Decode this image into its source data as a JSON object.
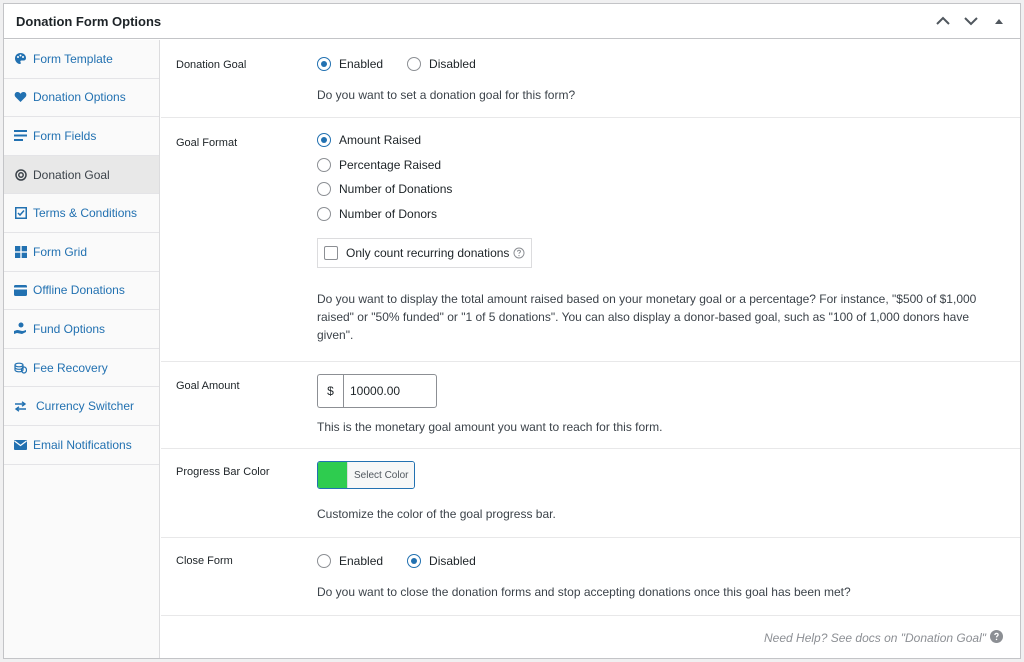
{
  "panel": {
    "title": "Donation Form Options"
  },
  "sidebar": {
    "items": [
      {
        "label": "Form Template",
        "icon": "palette-icon"
      },
      {
        "label": "Donation Options",
        "icon": "heart-icon"
      },
      {
        "label": "Form Fields",
        "icon": "list-icon"
      },
      {
        "label": "Donation Goal",
        "icon": "target-icon"
      },
      {
        "label": "Terms & Conditions",
        "icon": "checkbox-icon"
      },
      {
        "label": "Form Grid",
        "icon": "grid-icon"
      },
      {
        "label": "Offline Donations",
        "icon": "card-icon"
      },
      {
        "label": "Fund Options",
        "icon": "hand-coin-icon"
      },
      {
        "label": "Fee Recovery",
        "icon": "coins-icon"
      },
      {
        "label": "Currency Switcher",
        "icon": "arrows-icon"
      },
      {
        "label": "Email Notifications",
        "icon": "envelope-icon"
      }
    ]
  },
  "donation_goal": {
    "label": "Donation Goal",
    "options": [
      "Enabled",
      "Disabled"
    ],
    "selected": "Enabled",
    "description": "Do you want to set a donation goal for this form?"
  },
  "goal_format": {
    "label": "Goal Format",
    "options": [
      "Amount Raised",
      "Percentage Raised",
      "Number of Donations",
      "Number of Donors"
    ],
    "selected": "Amount Raised",
    "checkbox_label": "Only count recurring donations",
    "description": "Do you want to display the total amount raised based on your monetary goal or a percentage? For instance, \"$500 of $1,000 raised\" or \"50% funded\" or \"1 of 5 donations\". You can also display a donor-based goal, such as \"100 of 1,000 donors have given\"."
  },
  "goal_amount": {
    "label": "Goal Amount",
    "currency": "$",
    "value": "10000.00",
    "description": "This is the monetary goal amount you want to reach for this form."
  },
  "progress_bar_color": {
    "label": "Progress Bar Color",
    "color": "#2ecc4f",
    "button_label": "Select Color",
    "description": "Customize the color of the goal progress bar."
  },
  "close_form": {
    "label": "Close Form",
    "options": [
      "Enabled",
      "Disabled"
    ],
    "selected": "Disabled",
    "description": "Do you want to close the donation forms and stop accepting donations once this goal has been met?"
  },
  "footer": {
    "help_text": "Need Help? See docs on \"Donation Goal\""
  }
}
